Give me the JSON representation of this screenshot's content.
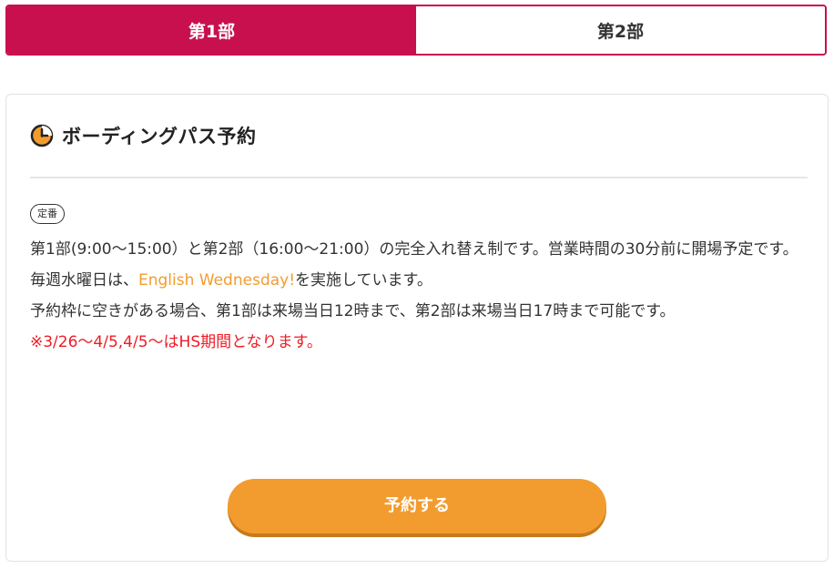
{
  "tabs": [
    {
      "label": "第1部",
      "active": true
    },
    {
      "label": "第2部",
      "active": false
    }
  ],
  "card": {
    "icon": "clock-icon",
    "title": "ボーディングパス予約",
    "badge": "定番",
    "lines": {
      "schedule": "第1部(9:00〜15:00）と第2部（16:00〜21:00）の完全入れ替え制です。営業時間の30分前に開場予定です。",
      "wednesday_prefix": "毎週水曜日は、",
      "wednesday_highlight": "English Wednesday!",
      "wednesday_suffix": "を実施しています。",
      "availability": "予約枠に空きがある場合、第1部は来場当日12時まで、第2部は来場当日17時まで可能です。",
      "notice": "※3/26〜4/5,4/5〜はHS期間となります。"
    },
    "button_label": "予約する"
  },
  "colors": {
    "accent": "#c8104e",
    "button": "#f29c2f",
    "highlight": "#f29c2f",
    "notice": "#ee1c25"
  }
}
